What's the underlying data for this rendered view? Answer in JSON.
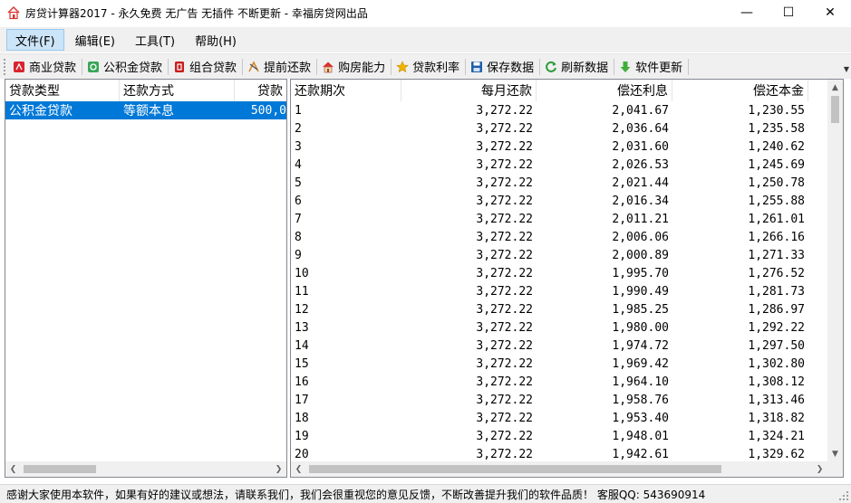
{
  "window": {
    "title": "房贷计算器2017 - 永久免费 无广告 无插件 不断更新 - 幸福房贷网出品",
    "minimize": "—",
    "maximize": "☐",
    "close": "✕"
  },
  "menu": [
    {
      "label": "文件(F)",
      "active": true
    },
    {
      "label": "编辑(E)",
      "active": false
    },
    {
      "label": "工具(T)",
      "active": false
    },
    {
      "label": "帮助(H)",
      "active": false
    }
  ],
  "toolbar": [
    {
      "label": "商业贷款",
      "icon": "commercial-loan-icon",
      "color": "#d9232e"
    },
    {
      "label": "公积金贷款",
      "icon": "provident-fund-icon",
      "color": "#3aa657"
    },
    {
      "label": "组合贷款",
      "icon": "combined-loan-icon",
      "color": "#c81e1e"
    },
    {
      "label": "提前还款",
      "icon": "prepayment-icon",
      "color": "#d88a2a"
    },
    {
      "label": "购房能力",
      "icon": "house-icon",
      "color": "#d9322e"
    },
    {
      "label": "贷款利率",
      "icon": "star-icon",
      "color": "#f0b400"
    },
    {
      "label": "保存数据",
      "icon": "save-icon",
      "color": "#1f5fa8"
    },
    {
      "label": "刷新数据",
      "icon": "refresh-icon",
      "color": "#2e9b3a"
    },
    {
      "label": "软件更新",
      "icon": "download-icon",
      "color": "#3fae3a"
    }
  ],
  "left_list": {
    "columns": [
      "贷款类型",
      "还款方式",
      "贷款"
    ],
    "rows": [
      {
        "type": "公积金贷款",
        "method": "等额本息",
        "amount": "500,0",
        "selected": true
      }
    ]
  },
  "right_list": {
    "columns": [
      "还款期次",
      "每月还款",
      "偿还利息",
      "偿还本金"
    ],
    "rows": [
      [
        "1",
        "3,272.22",
        "2,041.67",
        "1,230.55"
      ],
      [
        "2",
        "3,272.22",
        "2,036.64",
        "1,235.58"
      ],
      [
        "3",
        "3,272.22",
        "2,031.60",
        "1,240.62"
      ],
      [
        "4",
        "3,272.22",
        "2,026.53",
        "1,245.69"
      ],
      [
        "5",
        "3,272.22",
        "2,021.44",
        "1,250.78"
      ],
      [
        "6",
        "3,272.22",
        "2,016.34",
        "1,255.88"
      ],
      [
        "7",
        "3,272.22",
        "2,011.21",
        "1,261.01"
      ],
      [
        "8",
        "3,272.22",
        "2,006.06",
        "1,266.16"
      ],
      [
        "9",
        "3,272.22",
        "2,000.89",
        "1,271.33"
      ],
      [
        "10",
        "3,272.22",
        "1,995.70",
        "1,276.52"
      ],
      [
        "11",
        "3,272.22",
        "1,990.49",
        "1,281.73"
      ],
      [
        "12",
        "3,272.22",
        "1,985.25",
        "1,286.97"
      ],
      [
        "13",
        "3,272.22",
        "1,980.00",
        "1,292.22"
      ],
      [
        "14",
        "3,272.22",
        "1,974.72",
        "1,297.50"
      ],
      [
        "15",
        "3,272.22",
        "1,969.42",
        "1,302.80"
      ],
      [
        "16",
        "3,272.22",
        "1,964.10",
        "1,308.12"
      ],
      [
        "17",
        "3,272.22",
        "1,958.76",
        "1,313.46"
      ],
      [
        "18",
        "3,272.22",
        "1,953.40",
        "1,318.82"
      ],
      [
        "19",
        "3,272.22",
        "1,948.01",
        "1,324.21"
      ],
      [
        "20",
        "3,272.22",
        "1,942.61",
        "1,329.62"
      ]
    ]
  },
  "status": {
    "text": "感谢大家使用本软件，如果有好的建议或想法，请联系我们，我们会很重视您的意见反馈，不断改善提升我们的软件品质！ 客服QQ: 543690914"
  }
}
